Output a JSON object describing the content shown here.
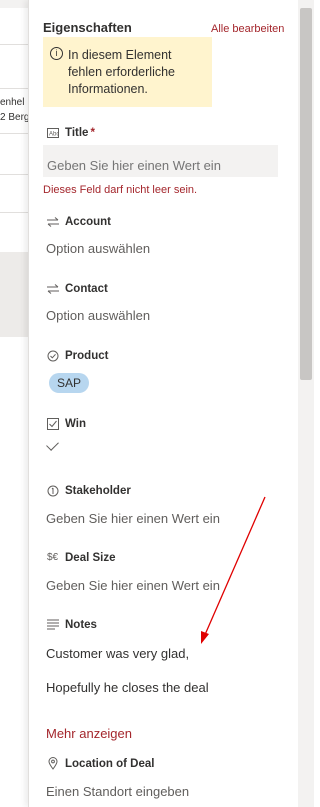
{
  "background": {
    "row_text": [
      "enhel",
      "2 Berg"
    ]
  },
  "panel": {
    "title": "Eigenschaften",
    "edit_all": "Alle bearbeiten",
    "warning": "In diesem Element fehlen erforderliche Informationen.",
    "fields": {
      "title": {
        "label": "Title",
        "required_mark": "*",
        "placeholder": "Geben Sie hier einen Wert ein",
        "error": "Dieses Feld darf nicht leer sein.",
        "icon": "text-field-icon"
      },
      "account": {
        "label": "Account",
        "value": "Option auswählen",
        "icon": "lookup-icon"
      },
      "contact": {
        "label": "Contact",
        "value": "Option auswählen",
        "icon": "lookup-icon"
      },
      "product": {
        "label": "Product",
        "value": "SAP",
        "icon": "choice-icon"
      },
      "win": {
        "label": "Win",
        "checked": true,
        "icon": "checkbox-icon"
      },
      "stakeholder": {
        "label": "Stakeholder",
        "value": "Geben Sie hier einen Wert ein",
        "icon": "number-icon"
      },
      "deal_size": {
        "label": "Deal Size",
        "value": "Geben Sie hier einen Wert ein",
        "icon": "currency-icon"
      },
      "notes": {
        "label": "Notes",
        "line1": "Customer was very glad,",
        "line2": "Hopefully he closes the deal",
        "icon": "multiline-text-icon"
      },
      "location": {
        "label": "Location of Deal",
        "value": "Einen Standort eingeben",
        "icon": "location-pin-icon"
      }
    },
    "more_link": "Mehr anzeigen",
    "icon_glyphs": {
      "info": "i",
      "currency": "$€"
    }
  },
  "colors": {
    "accent_red": "#a4262c",
    "warning_bg": "#fff4ce",
    "tag_bg": "#b7d6ef",
    "annotation_arrow": "#e00000"
  }
}
